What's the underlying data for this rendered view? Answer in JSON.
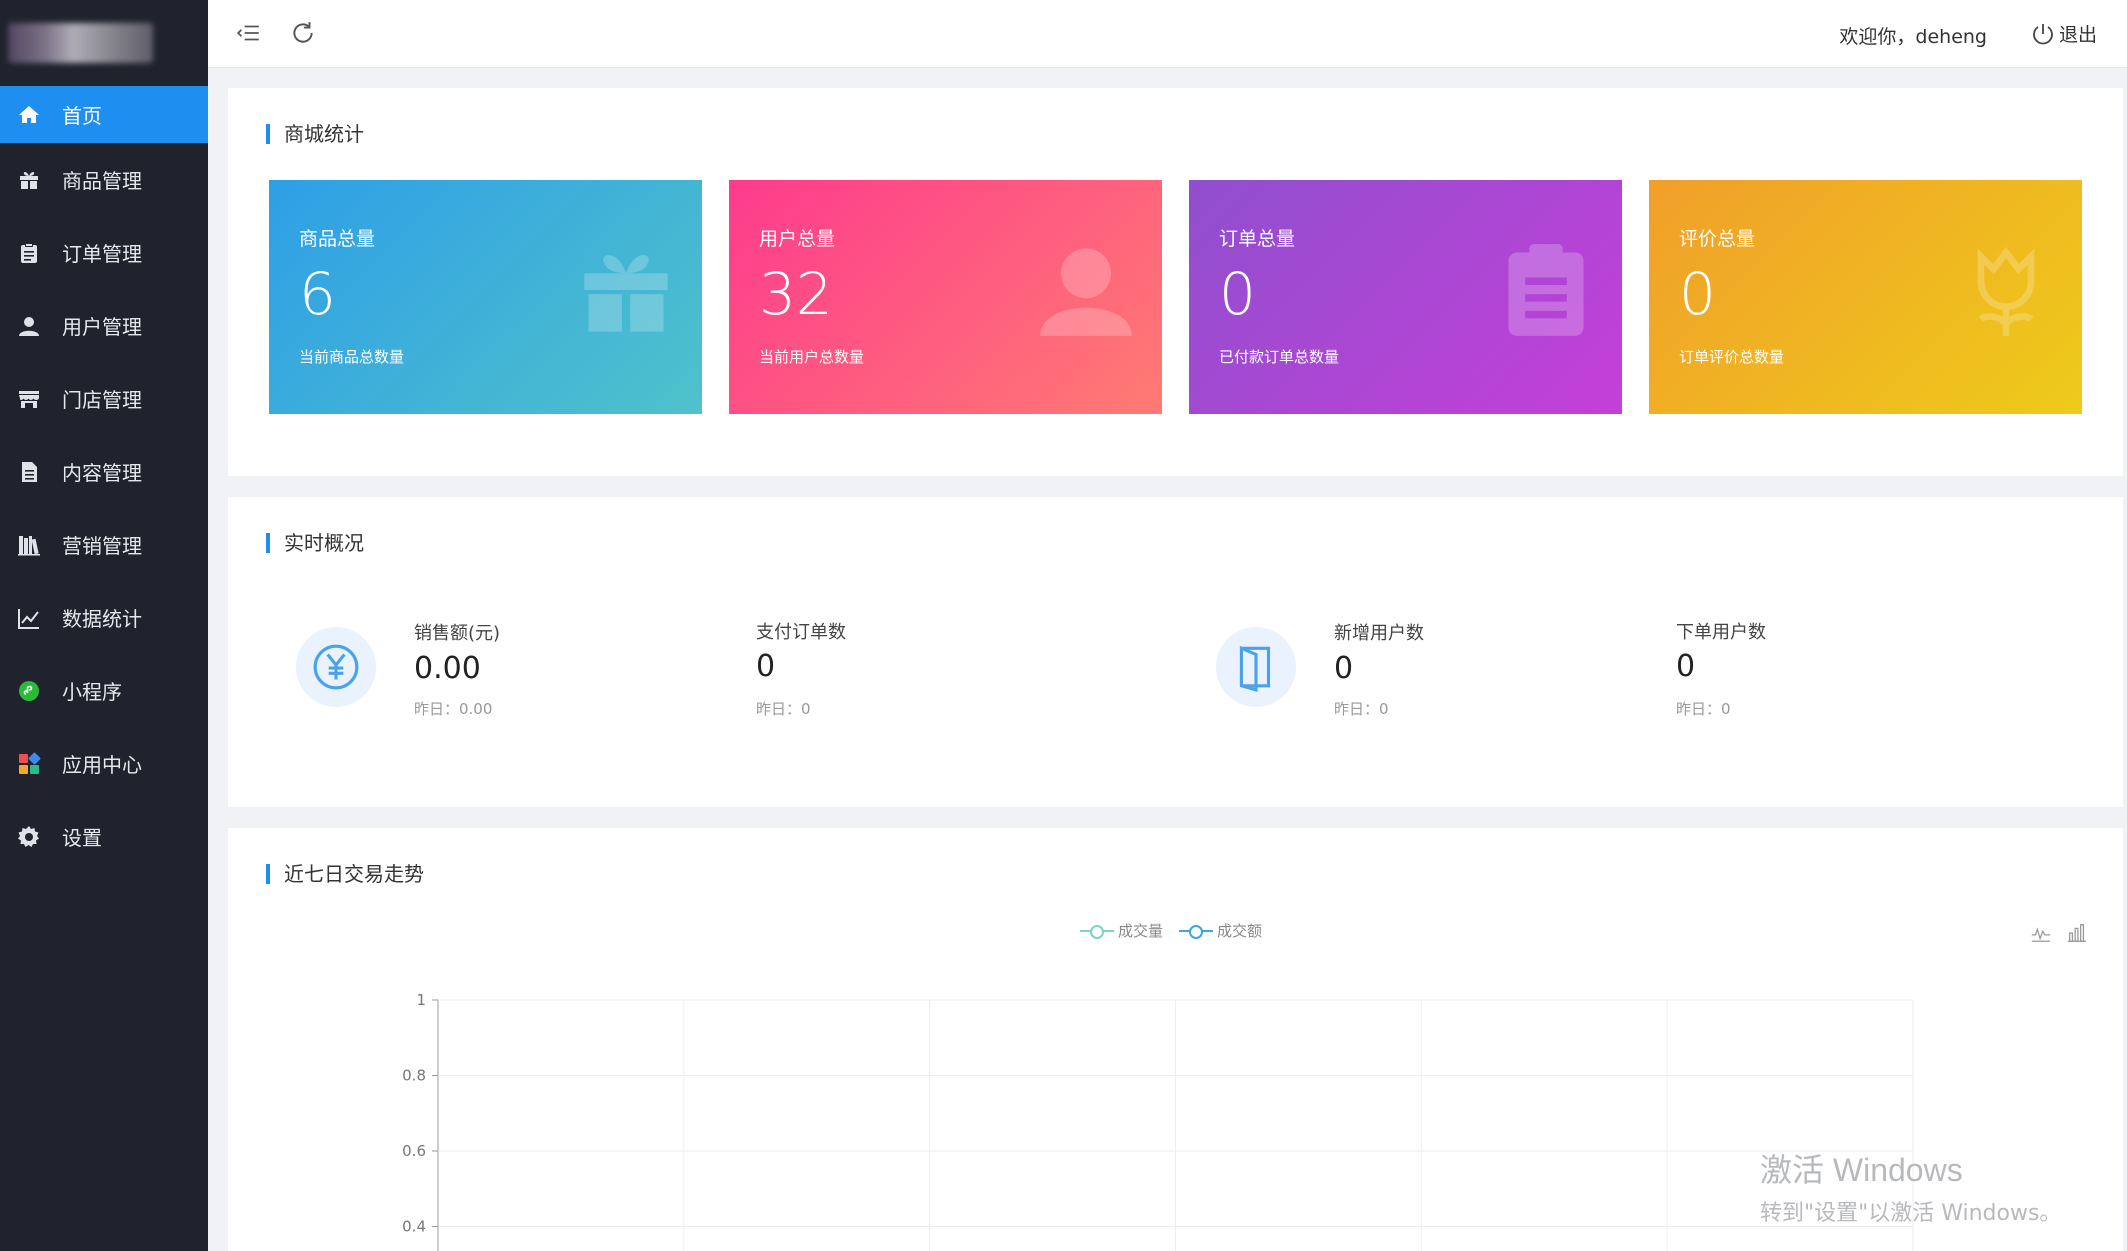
{
  "sidebar": {
    "items": [
      {
        "label": "首页",
        "icon": "home-icon",
        "active": true
      },
      {
        "label": "商品管理",
        "icon": "gift-icon"
      },
      {
        "label": "订单管理",
        "icon": "clipboard-icon"
      },
      {
        "label": "用户管理",
        "icon": "user-icon"
      },
      {
        "label": "门店管理",
        "icon": "store-icon"
      },
      {
        "label": "内容管理",
        "icon": "document-icon"
      },
      {
        "label": "营销管理",
        "icon": "books-icon"
      },
      {
        "label": "数据统计",
        "icon": "line-chart-icon"
      },
      {
        "label": "小程序",
        "icon": "miniprogram-icon"
      },
      {
        "label": "应用中心",
        "icon": "apps-icon"
      },
      {
        "label": "设置",
        "icon": "gear-icon"
      }
    ]
  },
  "header": {
    "welcome": "欢迎你，deheng",
    "logout": "退出"
  },
  "stats": {
    "title": "商城统计",
    "cards": [
      {
        "label": "商品总量",
        "value": "6",
        "sub": "当前商品总数量",
        "icon": "gift-icon",
        "gradient": [
          "#2e9fe6",
          "#4fc2cb"
        ]
      },
      {
        "label": "用户总量",
        "value": "32",
        "sub": "当前用户总数量",
        "icon": "user-icon",
        "gradient": [
          "#fd3b8d",
          "#ff7b73"
        ]
      },
      {
        "label": "订单总量",
        "value": "0",
        "sub": "已付款订单总数量",
        "icon": "clipboard-icon",
        "gradient": [
          "#8f4fce",
          "#c53fd9"
        ]
      },
      {
        "label": "评价总量",
        "value": "0",
        "sub": "订单评价总数量",
        "icon": "tulip-icon",
        "gradient": [
          "#f19f2a",
          "#eecb1a"
        ]
      }
    ]
  },
  "realtime": {
    "title": "实时概况",
    "items": [
      {
        "label": "销售额(元)",
        "value": "0.00",
        "prev": "昨日：0.00"
      },
      {
        "label": "支付订单数",
        "value": "0",
        "prev": "昨日：0"
      },
      {
        "label": "新增用户数",
        "value": "0",
        "prev": "昨日：0"
      },
      {
        "label": "下单用户数",
        "value": "0",
        "prev": "昨日：0"
      }
    ]
  },
  "trend": {
    "title": "近七日交易走势",
    "tools": [
      "line-toggle-icon",
      "bar-toggle-icon"
    ]
  },
  "chart_data": {
    "type": "line",
    "series": [
      {
        "name": "成交量",
        "color": "#7ed3c4",
        "values": []
      },
      {
        "name": "成交额",
        "color": "#3aa8d8",
        "values": []
      }
    ],
    "yticks": [
      "1",
      "0.8",
      "0.6",
      "0.4"
    ],
    "ylim": [
      0,
      1
    ],
    "grid": true,
    "legend": "top-center"
  },
  "watermark": {
    "title": "激活 Windows",
    "sub": "转到\"设置\"以激活 Windows。"
  }
}
